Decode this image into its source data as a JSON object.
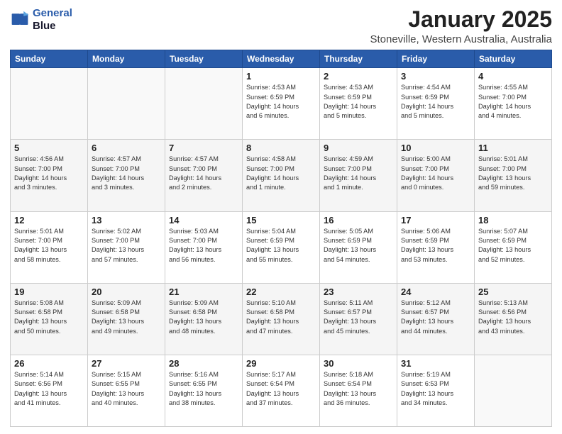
{
  "header": {
    "logo_line1": "General",
    "logo_line2": "Blue",
    "month": "January 2025",
    "location": "Stoneville, Western Australia, Australia"
  },
  "weekdays": [
    "Sunday",
    "Monday",
    "Tuesday",
    "Wednesday",
    "Thursday",
    "Friday",
    "Saturday"
  ],
  "weeks": [
    [
      {
        "day": "",
        "info": ""
      },
      {
        "day": "",
        "info": ""
      },
      {
        "day": "",
        "info": ""
      },
      {
        "day": "1",
        "info": "Sunrise: 4:53 AM\nSunset: 6:59 PM\nDaylight: 14 hours\nand 6 minutes."
      },
      {
        "day": "2",
        "info": "Sunrise: 4:53 AM\nSunset: 6:59 PM\nDaylight: 14 hours\nand 5 minutes."
      },
      {
        "day": "3",
        "info": "Sunrise: 4:54 AM\nSunset: 6:59 PM\nDaylight: 14 hours\nand 5 minutes."
      },
      {
        "day": "4",
        "info": "Sunrise: 4:55 AM\nSunset: 7:00 PM\nDaylight: 14 hours\nand 4 minutes."
      }
    ],
    [
      {
        "day": "5",
        "info": "Sunrise: 4:56 AM\nSunset: 7:00 PM\nDaylight: 14 hours\nand 3 minutes."
      },
      {
        "day": "6",
        "info": "Sunrise: 4:57 AM\nSunset: 7:00 PM\nDaylight: 14 hours\nand 3 minutes."
      },
      {
        "day": "7",
        "info": "Sunrise: 4:57 AM\nSunset: 7:00 PM\nDaylight: 14 hours\nand 2 minutes."
      },
      {
        "day": "8",
        "info": "Sunrise: 4:58 AM\nSunset: 7:00 PM\nDaylight: 14 hours\nand 1 minute."
      },
      {
        "day": "9",
        "info": "Sunrise: 4:59 AM\nSunset: 7:00 PM\nDaylight: 14 hours\nand 1 minute."
      },
      {
        "day": "10",
        "info": "Sunrise: 5:00 AM\nSunset: 7:00 PM\nDaylight: 14 hours\nand 0 minutes."
      },
      {
        "day": "11",
        "info": "Sunrise: 5:01 AM\nSunset: 7:00 PM\nDaylight: 13 hours\nand 59 minutes."
      }
    ],
    [
      {
        "day": "12",
        "info": "Sunrise: 5:01 AM\nSunset: 7:00 PM\nDaylight: 13 hours\nand 58 minutes."
      },
      {
        "day": "13",
        "info": "Sunrise: 5:02 AM\nSunset: 7:00 PM\nDaylight: 13 hours\nand 57 minutes."
      },
      {
        "day": "14",
        "info": "Sunrise: 5:03 AM\nSunset: 7:00 PM\nDaylight: 13 hours\nand 56 minutes."
      },
      {
        "day": "15",
        "info": "Sunrise: 5:04 AM\nSunset: 6:59 PM\nDaylight: 13 hours\nand 55 minutes."
      },
      {
        "day": "16",
        "info": "Sunrise: 5:05 AM\nSunset: 6:59 PM\nDaylight: 13 hours\nand 54 minutes."
      },
      {
        "day": "17",
        "info": "Sunrise: 5:06 AM\nSunset: 6:59 PM\nDaylight: 13 hours\nand 53 minutes."
      },
      {
        "day": "18",
        "info": "Sunrise: 5:07 AM\nSunset: 6:59 PM\nDaylight: 13 hours\nand 52 minutes."
      }
    ],
    [
      {
        "day": "19",
        "info": "Sunrise: 5:08 AM\nSunset: 6:58 PM\nDaylight: 13 hours\nand 50 minutes."
      },
      {
        "day": "20",
        "info": "Sunrise: 5:09 AM\nSunset: 6:58 PM\nDaylight: 13 hours\nand 49 minutes."
      },
      {
        "day": "21",
        "info": "Sunrise: 5:09 AM\nSunset: 6:58 PM\nDaylight: 13 hours\nand 48 minutes."
      },
      {
        "day": "22",
        "info": "Sunrise: 5:10 AM\nSunset: 6:58 PM\nDaylight: 13 hours\nand 47 minutes."
      },
      {
        "day": "23",
        "info": "Sunrise: 5:11 AM\nSunset: 6:57 PM\nDaylight: 13 hours\nand 45 minutes."
      },
      {
        "day": "24",
        "info": "Sunrise: 5:12 AM\nSunset: 6:57 PM\nDaylight: 13 hours\nand 44 minutes."
      },
      {
        "day": "25",
        "info": "Sunrise: 5:13 AM\nSunset: 6:56 PM\nDaylight: 13 hours\nand 43 minutes."
      }
    ],
    [
      {
        "day": "26",
        "info": "Sunrise: 5:14 AM\nSunset: 6:56 PM\nDaylight: 13 hours\nand 41 minutes."
      },
      {
        "day": "27",
        "info": "Sunrise: 5:15 AM\nSunset: 6:55 PM\nDaylight: 13 hours\nand 40 minutes."
      },
      {
        "day": "28",
        "info": "Sunrise: 5:16 AM\nSunset: 6:55 PM\nDaylight: 13 hours\nand 38 minutes."
      },
      {
        "day": "29",
        "info": "Sunrise: 5:17 AM\nSunset: 6:54 PM\nDaylight: 13 hours\nand 37 minutes."
      },
      {
        "day": "30",
        "info": "Sunrise: 5:18 AM\nSunset: 6:54 PM\nDaylight: 13 hours\nand 36 minutes."
      },
      {
        "day": "31",
        "info": "Sunrise: 5:19 AM\nSunset: 6:53 PM\nDaylight: 13 hours\nand 34 minutes."
      },
      {
        "day": "",
        "info": ""
      }
    ]
  ]
}
